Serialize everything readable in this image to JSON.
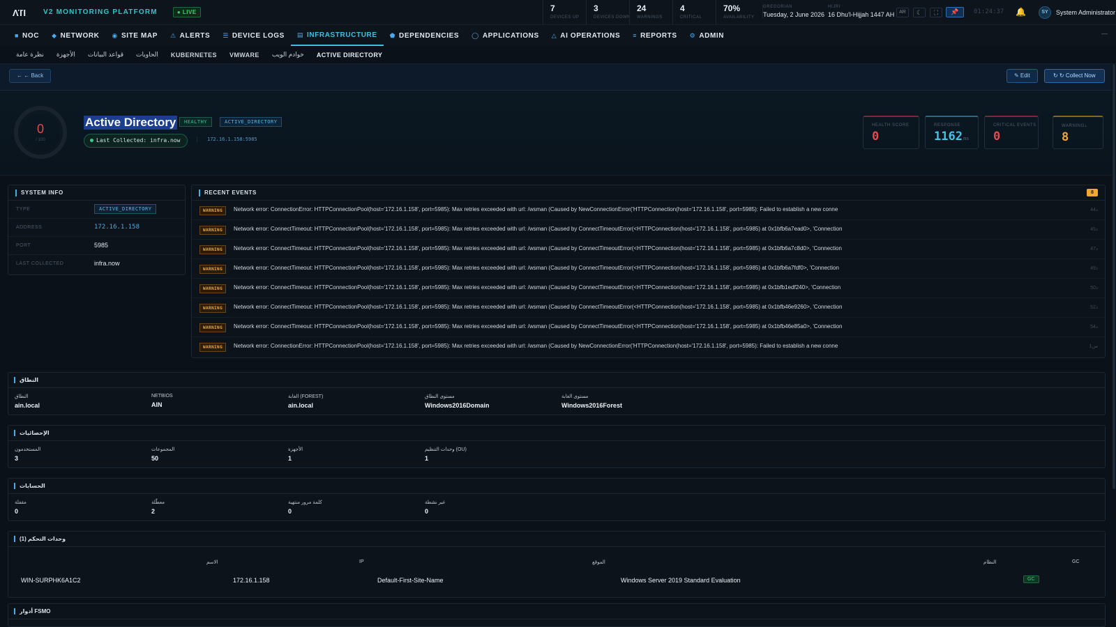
{
  "topbar": {
    "logo": "ΛΊΊ",
    "platform": "V2 MONITORING PLATFORM",
    "live": "● LIVE",
    "stats": [
      {
        "value": "7",
        "label": "DEVICES UP"
      },
      {
        "value": "3",
        "label": "DEVICES DOWN"
      },
      {
        "value": "24",
        "label": "WARNINGS"
      },
      {
        "value": "4",
        "label": "CRITICAL"
      },
      {
        "value": "70%",
        "label": "AVAILABILITY"
      }
    ],
    "gregorian_label": "GREGORIAN",
    "gregorian_date": "Tuesday, 2 June 2026",
    "hijri_label": "HIJRI",
    "hijri_date": "16 Dhu'l-Hijjah 1447 AH",
    "lang_toggle": "AR",
    "theme_icon": "☾",
    "fullscreen_icon": "⛶",
    "pin_icon": "📌",
    "clock": "01:24:37",
    "bell_icon": "🔔",
    "avatar_initials": "SY",
    "username": "System Administrator"
  },
  "nav": {
    "items": [
      {
        "icon": "■",
        "label": "NOC"
      },
      {
        "icon": "◆",
        "label": "NETWORK"
      },
      {
        "icon": "◉",
        "label": "SITE MAP"
      },
      {
        "icon": "⚠",
        "label": "ALERTS"
      },
      {
        "icon": "☰",
        "label": "DEVICE LOGS"
      },
      {
        "icon": "▤",
        "label": "INFRASTRUCTURE"
      },
      {
        "icon": "⬟",
        "label": "DEPENDENCIES"
      },
      {
        "icon": "◯",
        "label": "APPLICATIONS"
      },
      {
        "icon": "△",
        "label": "AI OPERATIONS"
      },
      {
        "icon": "≡",
        "label": "REPORTS"
      },
      {
        "icon": "⚙",
        "label": "ADMIN"
      }
    ],
    "collapse_icon": "—"
  },
  "subnav": {
    "items": [
      "نظرة عامة",
      "الأجهزة",
      "قواعد البيانات",
      "الحاويات",
      "KUBERNETES",
      "VMWARE",
      "خوادم الويب",
      "ACTIVE DIRECTORY"
    ]
  },
  "actions": {
    "back": "← ← Back",
    "edit": "✎ Edit",
    "collect": "↻ ↻ Collect Now"
  },
  "hero": {
    "gauge_value": "0",
    "gauge_max": "/ 100",
    "title": "Active Directory",
    "status": "HEALTHY",
    "type": "ACTIVE_DIRECTORY",
    "last_collected": "Last Collected: infra.now",
    "address": "172.16.1.158:5985",
    "kpis": {
      "health_label": "HEALTH SCORE",
      "health_value": "0",
      "response_label": "RESPONSE",
      "response_value": "1162",
      "response_unit": "ms",
      "critical_label": "CRITICAL EVENTS",
      "critical_value": "0",
      "warning_label": "WARNINGذ",
      "warning_value": "8"
    }
  },
  "system_info": {
    "title": "SYSTEM INFO",
    "rows": [
      {
        "key": "TYPE",
        "value": "ACTIVE_DIRECTORY"
      },
      {
        "key": "ADDRESS",
        "value": "172.16.1.158"
      },
      {
        "key": "PORT",
        "value": "5985"
      },
      {
        "key": "LAST COLLECTED",
        "value": "infra.now"
      }
    ]
  },
  "events": {
    "title": "RECENT EVENTS",
    "count": "8",
    "items": [
      {
        "severity": "WARNING",
        "message": "Network error: ConnectionError: HTTPConnectionPool(host='172.16.1.158', port=5985): Max retries exceeded with url: /wsman (Caused by NewConnectionError('HTTPConnection(host='172.16.1.158', port=5985): Failed to establish a new conne",
        "time": "44د"
      },
      {
        "severity": "WARNING",
        "message": "Network error: ConnectTimeout: HTTPConnectionPool(host='172.16.1.158', port=5985): Max retries exceeded with url: /wsman (Caused by ConnectTimeoutError(<HTTPConnection(host='172.16.1.158', port=5985) at 0x1bfb6a7ead0>, 'Connection",
        "time": "45د"
      },
      {
        "severity": "WARNING",
        "message": "Network error: ConnectTimeout: HTTPConnectionPool(host='172.16.1.158', port=5985): Max retries exceeded with url: /wsman (Caused by ConnectTimeoutError(<HTTPConnection(host='172.16.1.158', port=5985) at 0x1bfb6a7c8d0>, 'Connection",
        "time": "47د"
      },
      {
        "severity": "WARNING",
        "message": "Network error: ConnectTimeout: HTTPConnectionPool(host='172.16.1.158', port=5985): Max retries exceeded with url: /wsman (Caused by ConnectTimeoutError(<HTTPConnection(host='172.16.1.158', port=5985) at 0x1bfb6a7fdf0>, 'Connection",
        "time": "49د"
      },
      {
        "severity": "WARNING",
        "message": "Network error: ConnectTimeout: HTTPConnectionPool(host='172.16.1.158', port=5985): Max retries exceeded with url: /wsman (Caused by ConnectTimeoutError(<HTTPConnection(host='172.16.1.158', port=5985) at 0x1bfb1edf240>, 'Connection",
        "time": "50د"
      },
      {
        "severity": "WARNING",
        "message": "Network error: ConnectTimeout: HTTPConnectionPool(host='172.16.1.158', port=5985): Max retries exceeded with url: /wsman (Caused by ConnectTimeoutError(<HTTPConnection(host='172.16.1.158', port=5985) at 0x1bfb46e9260>, 'Connection",
        "time": "52د"
      },
      {
        "severity": "WARNING",
        "message": "Network error: ConnectTimeout: HTTPConnectionPool(host='172.16.1.158', port=5985): Max retries exceeded with url: /wsman (Caused by ConnectTimeoutError(<HTTPConnection(host='172.16.1.158', port=5985) at 0x1bfb46e85a0>, 'Connection",
        "time": "54د"
      },
      {
        "severity": "WARNING",
        "message": "Network error: ConnectionError: HTTPConnectionPool(host='172.16.1.158', port=5985): Max retries exceeded with url: /wsman (Caused by NewConnectionError('HTTPConnection(host='172.16.1.158', port=5985): Failed to establish a new conne",
        "time": "1س"
      }
    ]
  },
  "domain": {
    "title": "النطاق",
    "fields": [
      {
        "key": "النطاق",
        "value": "ain.local"
      },
      {
        "key": "NETBIOS",
        "value": "AIN"
      },
      {
        "key": "الغابة (FOREST)",
        "value": "ain.local"
      },
      {
        "key": "مستوى النطاق",
        "value": "Windows2016Domain"
      },
      {
        "key": "مستوى الغابة",
        "value": "Windows2016Forest"
      }
    ]
  },
  "stats": {
    "title": "الإحصائيات",
    "fields": [
      {
        "key": "المستخدمون",
        "value": "3"
      },
      {
        "key": "المجموعات",
        "value": "50"
      },
      {
        "key": "الأجهزة",
        "value": "1"
      },
      {
        "key": "وحدات التنظيم (OU)",
        "value": "1"
      }
    ]
  },
  "accounts": {
    "title": "الحسابات",
    "fields": [
      {
        "key": "مقفلة",
        "value": "0"
      },
      {
        "key": "معطّلة",
        "value": "2"
      },
      {
        "key": "كلمة مرور منتهية",
        "value": "0"
      },
      {
        "key": "غير نشطة",
        "value": "0"
      }
    ]
  },
  "dcs": {
    "title": "وحدات التحكم (1)",
    "headers": {
      "name": "الاسم",
      "ip": "IP",
      "site": "الموقع",
      "os": "النظام",
      "gc": "GC"
    },
    "rows": [
      {
        "name": "WIN-SURPHK6A1C2",
        "ip": "172.16.1.158",
        "site": "Default-First-Site-Name",
        "os": "Windows Server 2019 Standard Evaluation",
        "gc": "GC"
      }
    ]
  },
  "fsmo": {
    "title": "أدوار FSMO"
  }
}
